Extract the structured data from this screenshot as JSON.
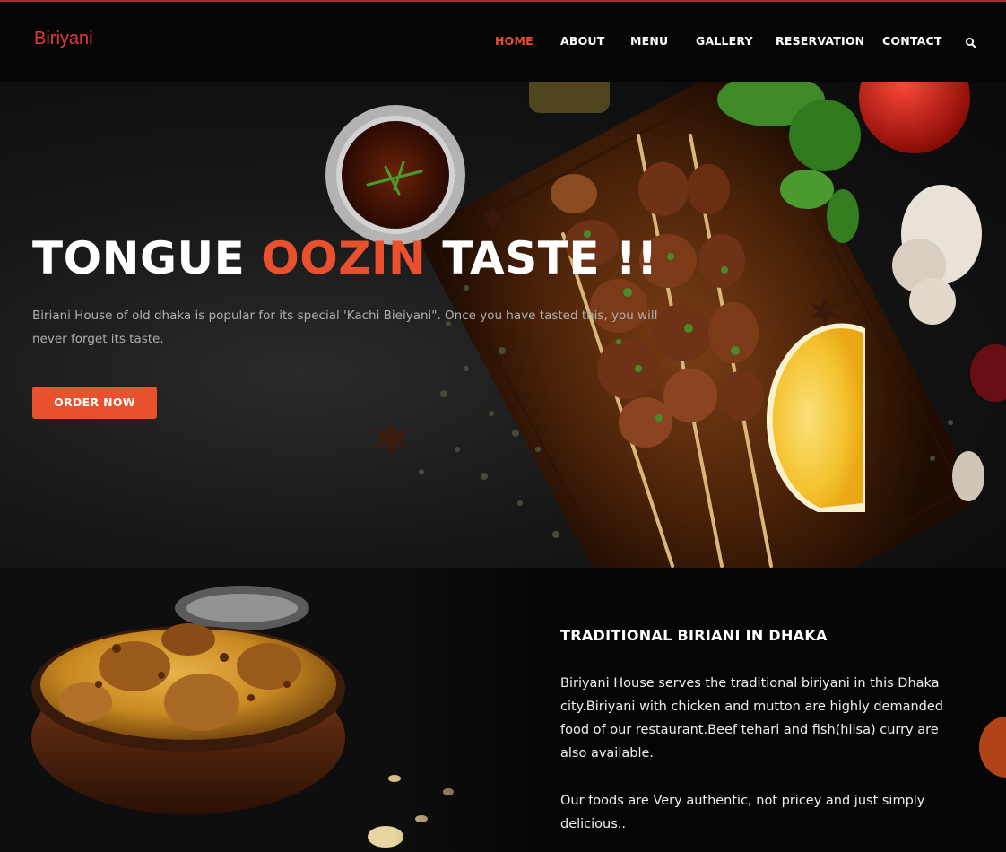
{
  "brand": {
    "logo_text": "Biriyani",
    "accent_color": "#e8502e"
  },
  "nav": {
    "items": [
      {
        "label": "HOME",
        "active": true
      },
      {
        "label": "ABOUT",
        "active": false
      },
      {
        "label": "MENU",
        "active": false
      },
      {
        "label": "GALLERY",
        "active": false
      },
      {
        "label": "RESERVATION",
        "active": false
      },
      {
        "label": "CONTACT",
        "active": false
      }
    ],
    "search_icon": "search-icon"
  },
  "hero": {
    "title_part1": "TONGUE",
    "title_accent": "OOZIN",
    "title_part2": "TASTE !!",
    "description": "Biriani House of old dhaka is popular for its special 'Kachi Bieiyani\". Once you have tasted this, you will never forget its taste.",
    "cta_label": "ORDER NOW"
  },
  "about": {
    "title": "TRADITIONAL BIRIANI IN DHAKA",
    "paragraph1": "Biriyani House serves the traditional biriyani in this Dhaka city.Biriyani with chicken and mutton are highly demanded food of our restaurant.Beef tehari and fish(hilsa) curry are also available.",
    "paragraph2": "Our foods are Very authentic, not pricey and just simply delicious.."
  }
}
